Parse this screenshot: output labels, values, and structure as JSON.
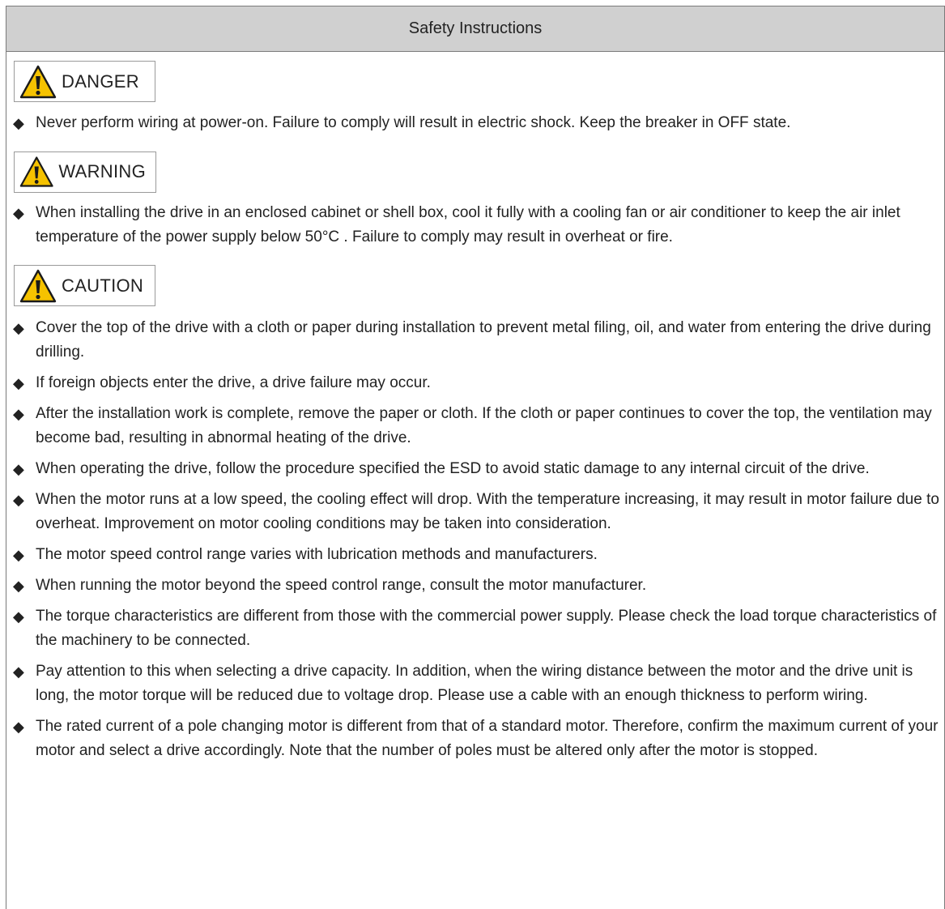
{
  "header": {
    "title": "Safety Instructions"
  },
  "colors": {
    "header_bg": "#d0d0d0",
    "warning_yellow": "#f5c200",
    "border": "#7a7a7a"
  },
  "bullet_symbol": "◆",
  "sections": [
    {
      "label": "DANGER",
      "icon": "warning-triangle-icon",
      "items": [
        "Never perform wiring at power-on. Failure to comply will result in electric shock. Keep the breaker in OFF state."
      ]
    },
    {
      "label": "WARNING",
      "icon": "warning-triangle-icon",
      "items": [
        "When installing the drive in an enclosed cabinet or shell box, cool it fully with a cooling fan or air conditioner to keep the air inlet temperature of the power supply below 50°C . Failure to comply may result in overheat or fire."
      ]
    },
    {
      "label": "CAUTION",
      "icon": "warning-triangle-icon",
      "items": [
        "Cover the top of the drive with a cloth or paper during installation to prevent metal filing, oil, and water from entering the drive during drilling.",
        "If foreign objects enter the drive, a drive failure may occur.",
        "After the installation work is complete, remove the paper or cloth. If the cloth or paper continues to cover the top, the ventilation may become bad, resulting in abnormal heating of the drive.",
        "When operating the drive, follow the procedure specified the ESD to avoid static damage to any internal circuit of the drive.",
        "When the motor runs at a low speed, the cooling effect will drop. With the temperature increasing, it may result in motor failure due to overheat. Improvement on motor cooling conditions may be taken into consideration.",
        "The motor speed control range varies with lubrication methods and manufacturers.",
        "When running the motor beyond the speed control range, consult the motor manufacturer.",
        "The torque characteristics are different from those with the commercial power supply. Please check the load torque characteristics of the machinery to be connected.",
        "Pay attention to this when selecting a drive capacity. In addition, when the wiring distance between the motor and the drive unit is long, the motor torque will be reduced due to voltage drop. Please use a cable with an enough thickness to perform wiring.",
        "The rated current of a pole changing motor is different from that of a standard motor. Therefore, confirm the maximum current of your motor and select a drive accordingly. Note that the number of poles must be altered only after the motor is stopped."
      ]
    }
  ]
}
